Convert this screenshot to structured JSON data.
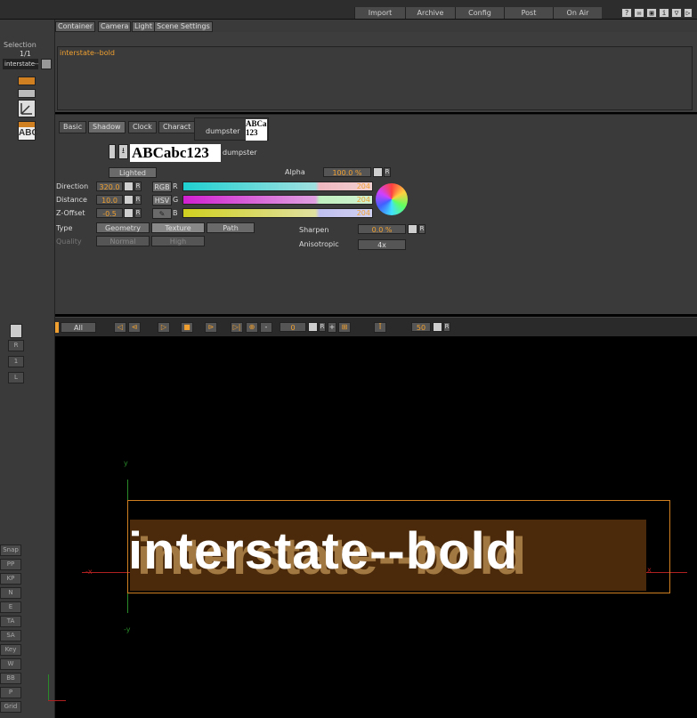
{
  "topbar": {
    "buttons": [
      "Import",
      "Archive",
      "Config",
      "Post",
      "On Air"
    ]
  },
  "tabs": [
    "Container",
    "Camera",
    "Light",
    "Scene Settings"
  ],
  "selection": {
    "label": "Selection",
    "count": "1/1",
    "name": "interstate--bold"
  },
  "script": {
    "text": "interstate--bold"
  },
  "subtabs": [
    "Basic",
    "Shadow",
    "Clock",
    "Charact"
  ],
  "font_preview": {
    "sample": "ABCabc123",
    "name": "dumpster",
    "tooltip": "dumpster",
    "tooltip_sample": "ABCa 123"
  },
  "shadow": {
    "lighted_label": "Lighted",
    "alpha_label": "Alpha",
    "alpha_value": "100.0 %",
    "direction_label": "Direction",
    "direction_value": "320.0",
    "distance_label": "Distance",
    "distance_value": "10.0",
    "zoffset_label": "Z-Offset",
    "zoffset_value": "-0.5",
    "rgb_label": "RGB",
    "hsv_label": "HSV",
    "r_label": "R",
    "g_label": "G",
    "b_label": "B",
    "r_value": "204",
    "g_value": "204",
    "b_value": "204",
    "type_label": "Type",
    "type_options": [
      "Geometry",
      "Texture",
      "Path"
    ],
    "quality_label": "Quality",
    "quality_options": [
      "Normal",
      "High"
    ],
    "sharpen_label": "Sharpen",
    "sharpen_value": "0.0 %",
    "aniso_label": "Anisotropic",
    "aniso_value": "4x"
  },
  "timeline": {
    "all_label": "All",
    "frame_value": "0",
    "end_value": "50"
  },
  "viewport": {
    "text": "interstate--bold",
    "axis_y": "y",
    "axis_neg_y": "-y",
    "axis_x": "x",
    "axis_neg_x": "-x"
  },
  "sidebar": {
    "buttons": [
      "Snap",
      "PP",
      "KP",
      "N",
      "E",
      "TA",
      "SA",
      "Key",
      "W",
      "BB",
      "P",
      "Grid"
    ]
  },
  "colors": {
    "accent": "#f0a030",
    "bbox": "#d08020",
    "shadow_fill": "#5a3010"
  }
}
